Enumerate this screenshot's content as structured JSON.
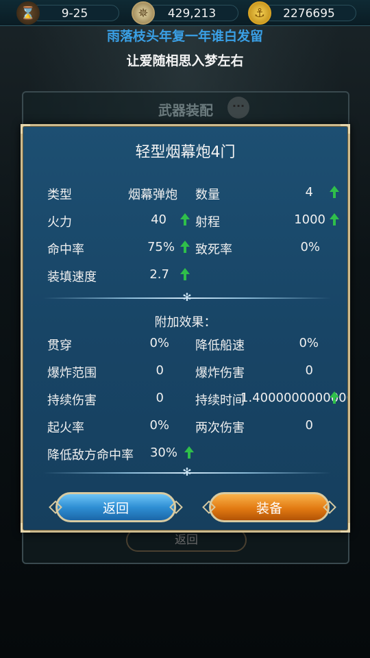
{
  "topbar": {
    "date": "9-25",
    "compass_value": "429,213",
    "gold_value": "2276695"
  },
  "banner": {
    "line1": "雨落枝头年复一年谁白发留",
    "line2": "让爱随相思入梦左右"
  },
  "background_panel": {
    "title": "武器装配",
    "return_label": "返回"
  },
  "dialog": {
    "title": "轻型烟幕炮4门",
    "stats": [
      {
        "label": "类型",
        "value": "烟幕弹炮",
        "up": false
      },
      {
        "label": "数量",
        "value": "4",
        "up": true
      },
      {
        "label": "火力",
        "value": "40",
        "up": true
      },
      {
        "label": "射程",
        "value": "1000",
        "up": true
      },
      {
        "label": "命中率",
        "value": "75%",
        "up": true
      },
      {
        "label": "致死率",
        "value": "0%",
        "up": false
      },
      {
        "label": "装填速度",
        "value": "2.7",
        "up": true
      }
    ],
    "extra_title": "附加效果：",
    "effects": [
      {
        "label": "贯穿",
        "value": "0%",
        "up": false
      },
      {
        "label": "降低船速",
        "value": "0%",
        "up": false
      },
      {
        "label": "爆炸范围",
        "value": "0",
        "up": false
      },
      {
        "label": "爆炸伤害",
        "value": "0",
        "up": false
      },
      {
        "label": "持续伤害",
        "value": "0",
        "up": false
      },
      {
        "label": "持续时间",
        "value": "1.4000000000000000",
        "up": true
      },
      {
        "label": "起火率",
        "value": "0%",
        "up": false
      },
      {
        "label": "两次伤害",
        "value": "0",
        "up": false
      },
      {
        "label": "降低敌方命中率",
        "value": "30%",
        "up": true
      }
    ],
    "buttons": {
      "back": "返回",
      "equip": "装备"
    }
  },
  "colors": {
    "banner_blue": "#3aa0e6",
    "dialog_bg": "#1d4f72",
    "frame_gold": "#cdbb8e",
    "up_arrow": "#2fbf4a",
    "btn_blue": "#2f8fd4",
    "btn_orange": "#e27a12"
  }
}
